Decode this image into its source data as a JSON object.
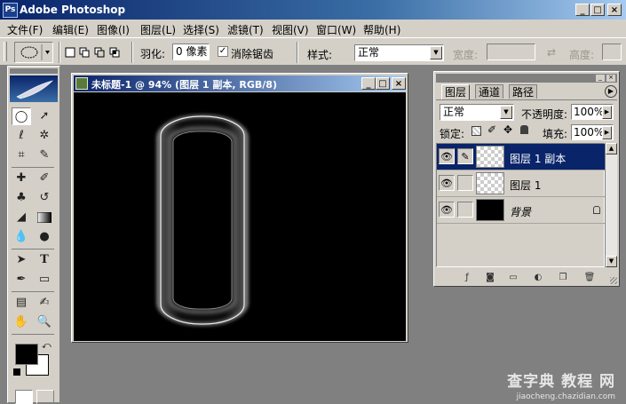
{
  "app": {
    "title": "Adobe Photoshop",
    "icon_label": "Ps"
  },
  "window_buttons": {
    "minimize": "_",
    "maximize": "□",
    "close": "×"
  },
  "menu": [
    "文件(F)",
    "编辑(E)",
    "图像(I)",
    "图层(L)",
    "选择(S)",
    "滤镜(T)",
    "视图(V)",
    "窗口(W)",
    "帮助(H)"
  ],
  "options": {
    "feather_label": "羽化:",
    "feather_value": "0 像素",
    "antialias_label": "消除锯齿",
    "antialias_checked": true,
    "style_label": "样式:",
    "style_value": "正常",
    "width_label": "宽度:",
    "height_label": "高度:",
    "swap_icon": "⇄"
  },
  "toolbox": {
    "tools": [
      "marquee-tool",
      "move-tool",
      "lasso-tool",
      "magic-wand-tool",
      "crop-tool",
      "slice-tool",
      "healing-brush-tool",
      "brush-tool",
      "clone-stamp-tool",
      "history-brush-tool",
      "eraser-tool",
      "gradient-tool",
      "blur-tool",
      "dodge-tool",
      "path-selection-tool",
      "type-tool",
      "pen-tool",
      "shape-tool",
      "notes-tool",
      "eyedropper-tool",
      "hand-tool",
      "zoom-tool"
    ],
    "foreground_color": "#000000",
    "background_color": "#ffffff"
  },
  "document": {
    "title": "未标题-1 @ 94% (图层 1 副本, RGB/8)",
    "canvas_color": "#000000"
  },
  "layers_panel": {
    "tabs": [
      "图层",
      "通道",
      "路径"
    ],
    "active_tab": "图层",
    "blend_mode": "正常",
    "opacity_label": "不透明度:",
    "opacity_value": "100%",
    "lock_label": "锁定:",
    "fill_label": "填充:",
    "fill_value": "100%",
    "layers": [
      {
        "name": "图层 1 副本",
        "active": true,
        "thumb": "transparent"
      },
      {
        "name": "图层 1",
        "active": false,
        "thumb": "transparent"
      },
      {
        "name": "背景",
        "active": false,
        "thumb": "black",
        "locked": true
      }
    ]
  },
  "watermark": {
    "line1": "查字典 教程 网",
    "line2": "jiaocheng.chazidian.com"
  }
}
